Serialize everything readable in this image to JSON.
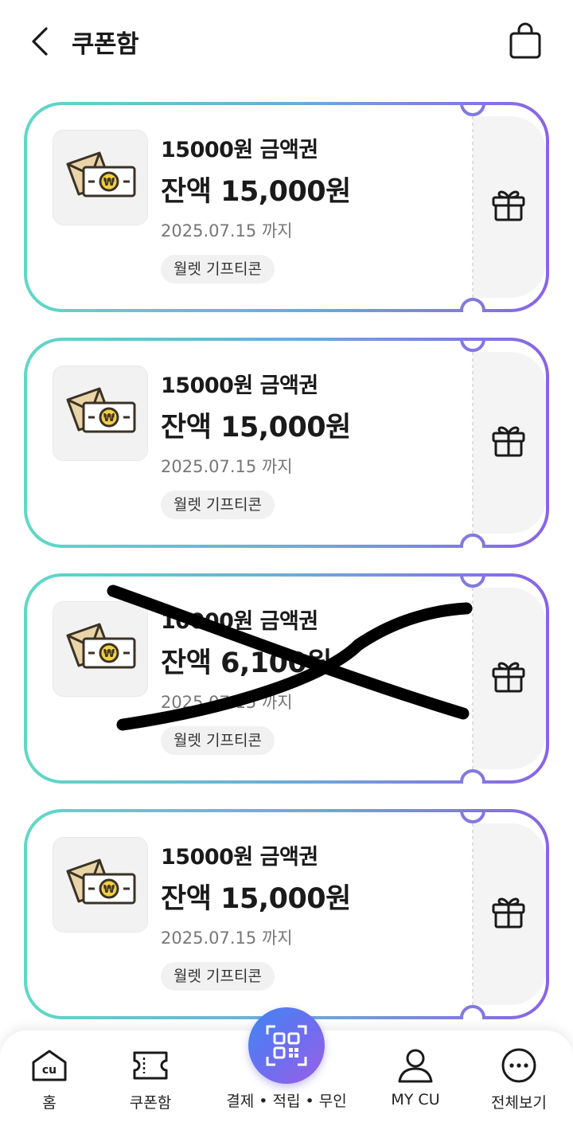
{
  "header": {
    "title": "쿠폰함"
  },
  "coupons": [
    {
      "name": "15000원 금액권",
      "balance": "잔액 15,000원",
      "expiry": "2025.07.15 까지",
      "tag": "월렛 기프티콘",
      "crossed_out": false
    },
    {
      "name": "15000원 금액권",
      "balance": "잔액 15,000원",
      "expiry": "2025.07.15 까지",
      "tag": "월렛 기프티콘",
      "crossed_out": false
    },
    {
      "name": "10000원 금액권",
      "balance": "잔액 6,100원",
      "expiry": "2025.07.15 까지",
      "tag": "월렛 기프티콘",
      "crossed_out": true
    },
    {
      "name": "15000원 금액권",
      "balance": "잔액 15,000원",
      "expiry": "2025.07.15 까지",
      "tag": "월렛 기프티콘",
      "crossed_out": false
    }
  ],
  "bottom_nav": {
    "items": [
      {
        "label": "홈",
        "icon": "home-cu-icon"
      },
      {
        "label": "쿠폰함",
        "icon": "ticket-icon"
      },
      {
        "label": "결제 • 적립 • 무인",
        "icon": "qr-code-icon"
      },
      {
        "label": "MY CU",
        "icon": "person-icon"
      },
      {
        "label": "전체보기",
        "icon": "more-icon"
      }
    ]
  },
  "colors": {
    "gradient_start": "#5fd8c6",
    "gradient_end": "#8a63e6",
    "qr_button_start": "#3f86f2",
    "qr_button_end": "#9a5fe6"
  }
}
